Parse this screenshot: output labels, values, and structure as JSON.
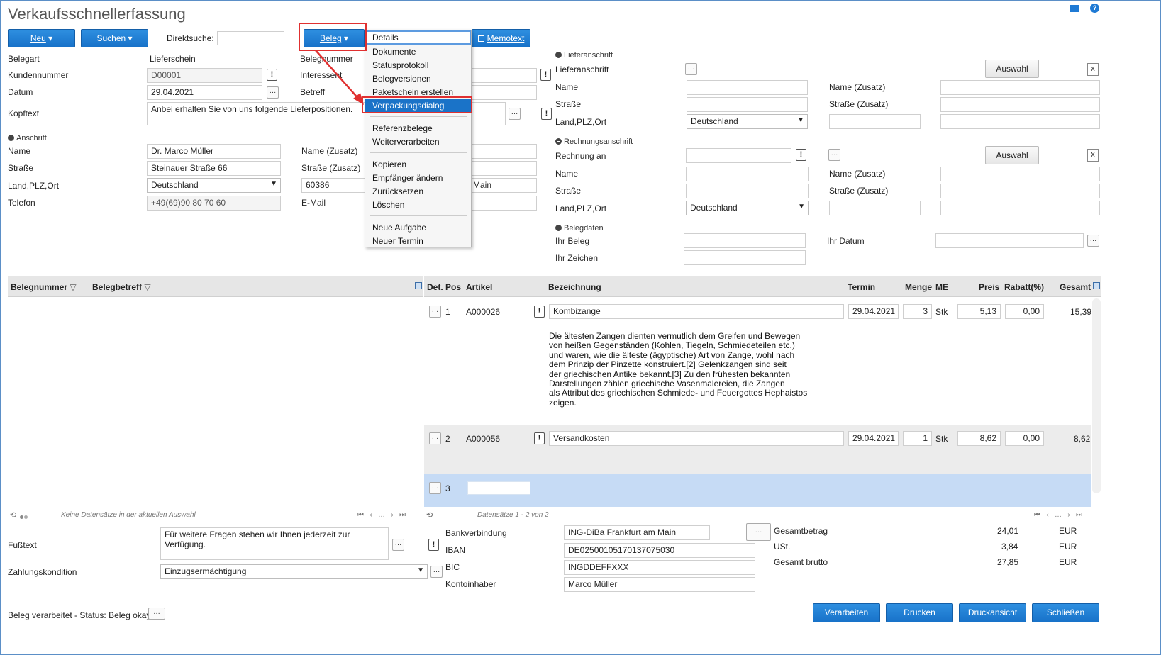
{
  "window": {
    "title": "Verkaufsschnellerfassung"
  },
  "toolbar": {
    "neu": "Neu",
    "suchen": "Suchen",
    "direktsuche_label": "Direktsuche:",
    "direktsuche_value": "",
    "beleg": "Beleg",
    "memotext": "Memotext"
  },
  "beleg_menu": {
    "items": [
      "Details",
      "Dokumente",
      "Statusprotokoll",
      "Belegversionen",
      "Paketschein erstellen",
      "Verpackungsdialog",
      "Referenzbelege",
      "Weiterverarbeiten",
      "Kopieren",
      "Empfänger ändern",
      "Zurücksetzen",
      "Löschen",
      "Neue Aufgabe",
      "Neuer Termin"
    ],
    "highlighted": "Verpackungsdialog"
  },
  "header": {
    "belegart_label": "Belegart",
    "belegart_value": "Lieferschein",
    "kundennummer_label": "Kundennummer",
    "kundennummer_value": "D00001",
    "datum_label": "Datum",
    "datum_value": "29.04.2021",
    "kopftext_label": "Kopftext",
    "kopftext_value": "Anbei erhalten Sie von uns folgende Lieferpositionen.",
    "belegnummer_label": "Belegnummer",
    "interessent_label": "Interessent",
    "betreff_label": "Betreff"
  },
  "anschrift": {
    "section": "Anschrift",
    "name_label": "Name",
    "name_value": "Dr. Marco Müller",
    "strasse_label": "Straße",
    "strasse_value": "Steinauer Straße 66",
    "land_label": "Land,PLZ,Ort",
    "land_value": "Deutschland",
    "plz_value": "60386",
    "ort_value": "Main",
    "telefon_label": "Telefon",
    "telefon_value": "+49(69)90 80 70 60",
    "name_zusatz_label": "Name (Zusatz)",
    "strasse_zusatz_label": "Straße (Zusatz)",
    "email_label": "E-Mail"
  },
  "lieferanschrift": {
    "section": "Lieferanschrift",
    "lieferanschrift_label": "Lieferanschrift",
    "auswahl": "Auswahl",
    "close": "x",
    "name_label": "Name",
    "name_zusatz_label": "Name (Zusatz)",
    "strasse_label": "Straße",
    "strasse_zusatz_label": "Straße (Zusatz)",
    "land_label": "Land,PLZ,Ort",
    "land_value": "Deutschland"
  },
  "rechnungsanschrift": {
    "section": "Rechnungsanschrift",
    "rechnung_an_label": "Rechnung an",
    "auswahl": "Auswahl",
    "close": "x",
    "name_label": "Name",
    "name_zusatz_label": "Name (Zusatz)",
    "strasse_label": "Straße",
    "strasse_zusatz_label": "Straße (Zusatz)",
    "land_label": "Land,PLZ,Ort",
    "land_value": "Deutschland"
  },
  "belegdaten": {
    "section": "Belegdaten",
    "ihr_beleg_label": "Ihr Beleg",
    "ihr_datum_label": "Ihr Datum",
    "ihr_zeichen_label": "Ihr Zeichen"
  },
  "left_grid": {
    "columns": [
      "Belegnummer",
      "Belegbetreff"
    ],
    "empty_text": "Keine Datensätze in der aktuellen Auswahl"
  },
  "positions": {
    "columns": [
      "Det.",
      "Pos",
      "Artikel",
      "Bezeichnung",
      "Termin",
      "Menge",
      "ME",
      "Preis",
      "Rabatt(%)",
      "Gesamt"
    ],
    "rows": [
      {
        "pos": "1",
        "artikel": "A000026",
        "bezeichnung": "Kombizange",
        "termin": "29.04.2021",
        "menge": "3",
        "me": "Stk",
        "preis": "5,13",
        "rabatt": "0,00",
        "gesamt": "15,39",
        "text": [
          "Die ältesten Zangen dienten vermutlich dem Greifen und Bewegen",
          "von heißen Gegenständen (Kohlen, Tiegeln, Schmiedeteilen etc.)",
          "und waren, wie die älteste (ägyptische) Art von Zange, wohl nach",
          "dem Prinzip der Pinzette konstruiert.[2] Gelenkzangen sind seit",
          "der griechischen Antike bekannt.[3] Zu den frühesten bekannten",
          "Darstellungen zählen griechische Vasenmalereien, die Zangen",
          "als Attribut des griechischen Schmiede- und Feuergottes Hephaistos",
          "zeigen."
        ]
      },
      {
        "pos": "2",
        "artikel": "A000056",
        "bezeichnung": "Versandkosten",
        "termin": "29.04.2021",
        "menge": "1",
        "me": "Stk",
        "preis": "8,62",
        "rabatt": "0,00",
        "gesamt": "8,62"
      },
      {
        "pos": "3"
      }
    ],
    "pager_text": "Datensätze 1 - 2 von 2"
  },
  "footer": {
    "fusstext_label": "Fußtext",
    "fusstext_value": "Für weitere Fragen stehen wir Ihnen jederzeit zur Verfügung.",
    "zahlung_label": "Zahlungskondition",
    "zahlung_value": "Einzugsermächtigung",
    "bank_label": "Bankverbindung",
    "bank_value": "ING-DiBa Frankfurt am Main",
    "iban_label": "IBAN",
    "iban_value": "DE02500105170137075030",
    "bic_label": "BIC",
    "bic_value": "INGDDEFFXXX",
    "inhaber_label": "Kontoinhaber",
    "inhaber_value": "Marco Müller",
    "gesamtbetrag_label": "Gesamtbetrag",
    "gesamtbetrag_value": "24,01",
    "ust_label": "USt.",
    "ust_value": "3,84",
    "brutto_label": "Gesamt brutto",
    "brutto_value": "27,85",
    "currency": "EUR",
    "status": "Beleg verarbeitet - Status: Beleg okay"
  },
  "actions": {
    "verarbeiten": "Verarbeiten",
    "drucken": "Drucken",
    "druckansicht": "Druckansicht",
    "schliessen": "Schließen"
  },
  "colors": {
    "accent": "#1f7ad4",
    "highlight": "#1a73c8",
    "selected_row": "#c6dbf5",
    "annotation": "#e03030"
  }
}
